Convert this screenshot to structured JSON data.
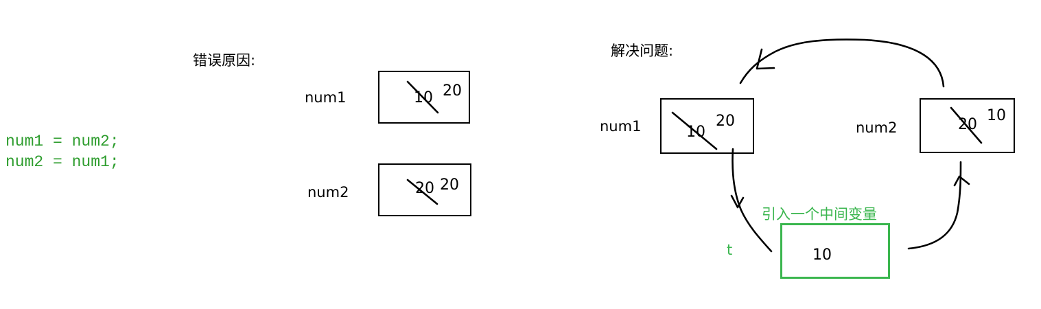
{
  "code": {
    "line1": "num1 = num2;",
    "line2": "num2 = num1;",
    "color": "#2e9d2e"
  },
  "left": {
    "title": "错误原因:",
    "num1": {
      "name": "num1",
      "old": "10",
      "new": "20"
    },
    "num2": {
      "name": "num2",
      "old": "20",
      "new": "20"
    }
  },
  "right": {
    "title": "解决问题:",
    "num1": {
      "name": "num1",
      "old": "10",
      "new": "20"
    },
    "num2": {
      "name": "num2",
      "old": "20",
      "new": "10"
    },
    "temp": {
      "name": "t",
      "value": "10",
      "caption": "引入一个中间变量"
    },
    "accent_color": "#3bb64f"
  }
}
